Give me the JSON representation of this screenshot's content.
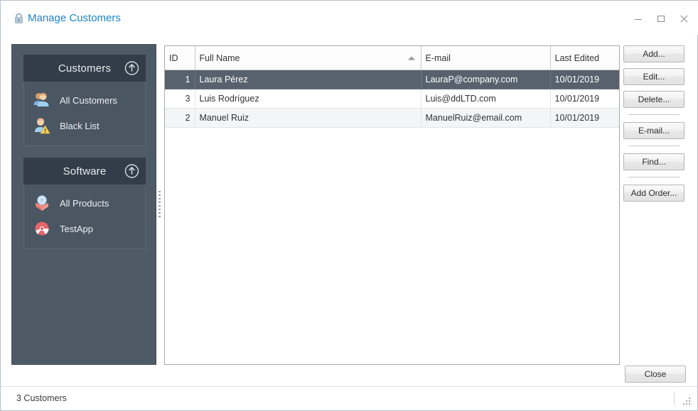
{
  "window": {
    "title": "Manage Customers",
    "title_icon": "lock-icon",
    "controls": {
      "minimize": "minimize-icon",
      "maximize": "maximize-icon",
      "close": "close-icon"
    }
  },
  "sidebar": {
    "groups": [
      {
        "title": "Customers",
        "collapse_icon": "circle-up-arrow-icon",
        "items": [
          {
            "label": "All Customers",
            "icon": "two-users-icon"
          },
          {
            "label": "Black List",
            "icon": "user-warning-icon"
          }
        ]
      },
      {
        "title": "Software",
        "collapse_icon": "circle-up-arrow-icon",
        "items": [
          {
            "label": "All Products",
            "icon": "cd-box-icon"
          },
          {
            "label": "TestApp",
            "icon": "disc-icon"
          }
        ]
      }
    ]
  },
  "table": {
    "columns": [
      {
        "label": "ID",
        "sort": ""
      },
      {
        "label": "Full Name",
        "sort": "asc"
      },
      {
        "label": "E-mail",
        "sort": ""
      },
      {
        "label": "Last Edited",
        "sort": ""
      }
    ],
    "rows": [
      {
        "id": "1",
        "name": "Laura Pérez",
        "email": "LauraP@company.com",
        "last_edited": "10/01/2019",
        "selected": true
      },
      {
        "id": "3",
        "name": "Luis Rodríguez",
        "email": "Luis@ddLTD.com",
        "last_edited": "10/01/2019",
        "selected": false
      },
      {
        "id": "2",
        "name": "Manuel Ruiz",
        "email": "ManuelRuiz@email.com",
        "last_edited": "10/01/2019",
        "selected": false
      }
    ]
  },
  "actions": {
    "add": "Add...",
    "edit": "Edit...",
    "delete": "Delete...",
    "email": "E-mail...",
    "find": "Find...",
    "add_order": "Add Order...",
    "close": "Close"
  },
  "statusbar": {
    "text": "3 Customers",
    "grip_icon": "resize-grip-icon"
  },
  "colors": {
    "title_text": "#1b85c8",
    "sidebar_bg": "#4e5a66",
    "sidebar_header_bg": "#333d49",
    "row_selected_bg": "#58626e",
    "row_alt_bg": "#f4f5f6"
  }
}
